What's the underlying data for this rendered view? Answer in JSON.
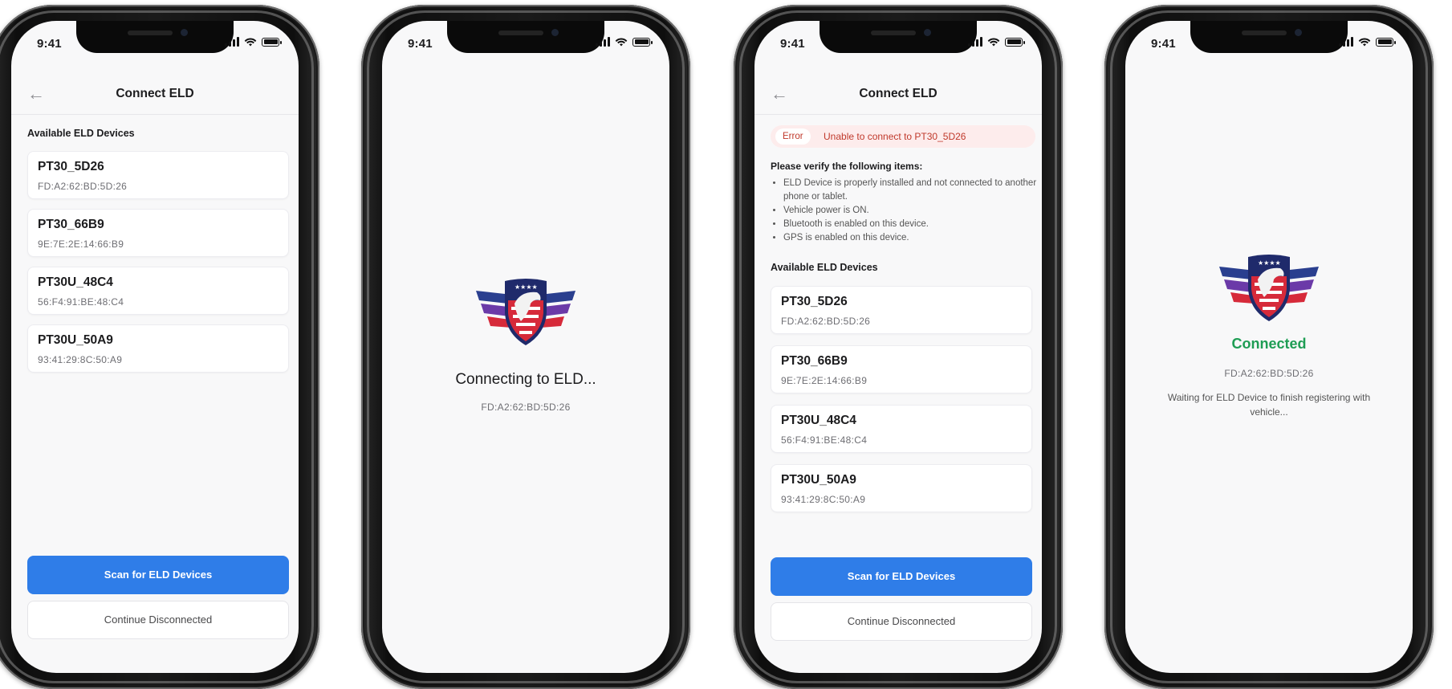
{
  "status_bar": {
    "time": "9:41"
  },
  "header": {
    "back_icon": "←",
    "title": "Connect ELD"
  },
  "available_title": "Available ELD Devices",
  "devices": [
    {
      "name": "PT30_5D26",
      "mac": "FD:A2:62:BD:5D:26"
    },
    {
      "name": "PT30_66B9",
      "mac": "9E:7E:2E:14:66:B9"
    },
    {
      "name": "PT30U_48C4",
      "mac": "56:F4:91:BE:48:C4"
    },
    {
      "name": "PT30U_50A9",
      "mac": "93:41:29:8C:50:A9"
    }
  ],
  "buttons": {
    "scan": "Scan for ELD Devices",
    "continue": "Continue Disconnected"
  },
  "connecting": {
    "text": "Connecting to ELD...",
    "mac": "FD:A2:62:BD:5D:26"
  },
  "error": {
    "label": "Error",
    "message": "Unable to connect to PT30_5D26",
    "verify_title": "Please verify the following items:",
    "items": [
      "ELD Device is properly installed and not connected to another phone or tablet.",
      "Vehicle power is ON.",
      "Bluetooth is enabled on this device.",
      "GPS is enabled on this device."
    ]
  },
  "connected": {
    "title": "Connected",
    "mac": "FD:A2:62:BD:5D:26",
    "message": "Waiting for ELD Device to finish registering with vehicle..."
  },
  "colors": {
    "primary": "#2f7de8",
    "success": "#1e9d54",
    "error": "#c0392b",
    "logo_red": "#d62a3a",
    "logo_blue": "#2a3f8f",
    "logo_purple": "#6b3aa8"
  },
  "icons": {
    "back": "arrow-left-icon",
    "signal": "signal-icon",
    "wifi": "wifi-icon",
    "battery": "battery-icon",
    "logo": "eagle-shield-logo"
  }
}
